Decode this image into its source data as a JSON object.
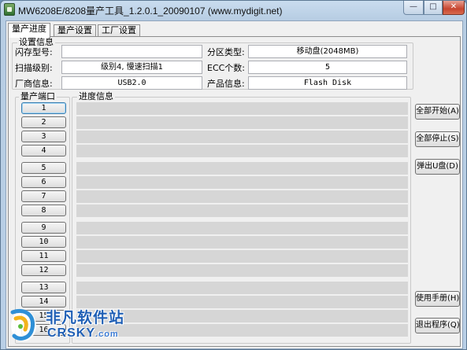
{
  "window": {
    "title": "MW6208E/8208量产工具_1.2.0.1_20090107 (www.mydigit.net)",
    "minimize_glyph": "—",
    "maximize_glyph": "□",
    "close_glyph": "✕"
  },
  "tabs": [
    {
      "label": "量产进度",
      "active": true
    },
    {
      "label": "量产设置",
      "active": false
    },
    {
      "label": "工厂设置",
      "active": false
    }
  ],
  "settings": {
    "group_title": "设置信息",
    "flash_model_label": "闪存型号:",
    "flash_model_value": "",
    "partition_type_label": "分区类型:",
    "partition_type_value": "移动盘(2048MB)",
    "scan_level_label": "扫描级别:",
    "scan_level_value": "级别4, 慢速扫描1",
    "ecc_label": "ECC个数:",
    "ecc_value": "5",
    "vendor_label": "厂商信息:",
    "vendor_value": "USB2.0",
    "product_label": "产品信息:",
    "product_value": "Flash Disk"
  },
  "ports": {
    "group_title": "量产端口",
    "buttons": [
      "1",
      "2",
      "3",
      "4",
      "5",
      "6",
      "7",
      "8",
      "9",
      "10",
      "11",
      "12",
      "13",
      "14",
      "15",
      "16"
    ]
  },
  "progress": {
    "group_title": "进度信息"
  },
  "actions": {
    "start_all": "全部开始(A)",
    "stop_all": "全部停止(S)",
    "eject": "弹出U盘(D)",
    "manual": "使用手册(H)",
    "exit": "退出程序(Q)"
  },
  "watermark": {
    "cn": "非凡软件站",
    "en": "CRSKY",
    "en_suffix": ".com"
  }
}
